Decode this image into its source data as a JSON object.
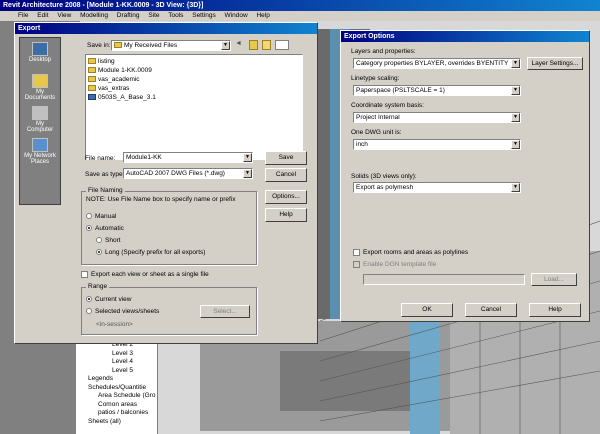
{
  "app": {
    "title": "Revit Architecture 2008 - [Module 1-KK.0009 - 3D View: {3D}]",
    "menus": [
      "File",
      "Edit",
      "View",
      "Modelling",
      "Drafting",
      "Site",
      "Tools",
      "Settings",
      "Window",
      "Help"
    ]
  },
  "export_dialog": {
    "title": "Export",
    "save_in_label": "Save in:",
    "save_in_value": "My Received Files",
    "places": [
      "Desktop",
      "My Documents",
      "My Computer",
      "My Network Places"
    ],
    "files": [
      "listing",
      "Module 1-KK.0009",
      "vas_academic",
      "vas_extras",
      "0503S_A_Base_3.1"
    ],
    "file_name_label": "File name:",
    "file_name_value": "Module1-KK",
    "save_as_label": "Save as type:",
    "save_as_value": "AutoCAD 2007 DWG Files (*.dwg)",
    "save_button": "Save",
    "cancel_button": "Cancel",
    "options_button": "Options...",
    "help_button": "Help",
    "naming_group": "File Naming",
    "naming_note": "NOTE: Use File Name box to specify name or prefix",
    "manual": "Manual",
    "automatic": "Automatic",
    "short": "Short",
    "long": "Long (Specify prefix for all exports)",
    "export_each": "Export each view or sheet as a single file",
    "range_group": "Range",
    "current_view": "Current view",
    "selected_views": "Selected views/sheets",
    "select_button": "Select...",
    "in_session": "<in-session>"
  },
  "options_dialog": {
    "title": "Export Options",
    "layers_label": "Layers and properties:",
    "layers_value": "Category properties BYLAYER, overrides BYENTITY",
    "layer_settings_button": "Layer Settings...",
    "linetype_label": "Linetype scaling:",
    "linetype_value": "Paperspace (PSLTSCALE = 1)",
    "coord_label": "Coordinate system basis:",
    "coord_value": "Project Internal",
    "unit_label": "One DWG unit is:",
    "unit_value": "inch",
    "solids_label": "Solids (3D views only):",
    "solids_value": "Export as polymesh",
    "rooms_check": "Export rooms and areas as polylines",
    "dgn_check": "Enable DGN template file",
    "load_button": "Load...",
    "ok_button": "OK",
    "cancel_button": "Cancel",
    "help_button": "Help"
  },
  "tree": [
    "Level 2",
    "Level 3",
    "Level 4",
    "Level 5",
    "Legends",
    "Schedules/Quantitie",
    "Area Schedule (Gro",
    "Comon areas",
    "patios / balconies",
    "Sheets (all)"
  ]
}
